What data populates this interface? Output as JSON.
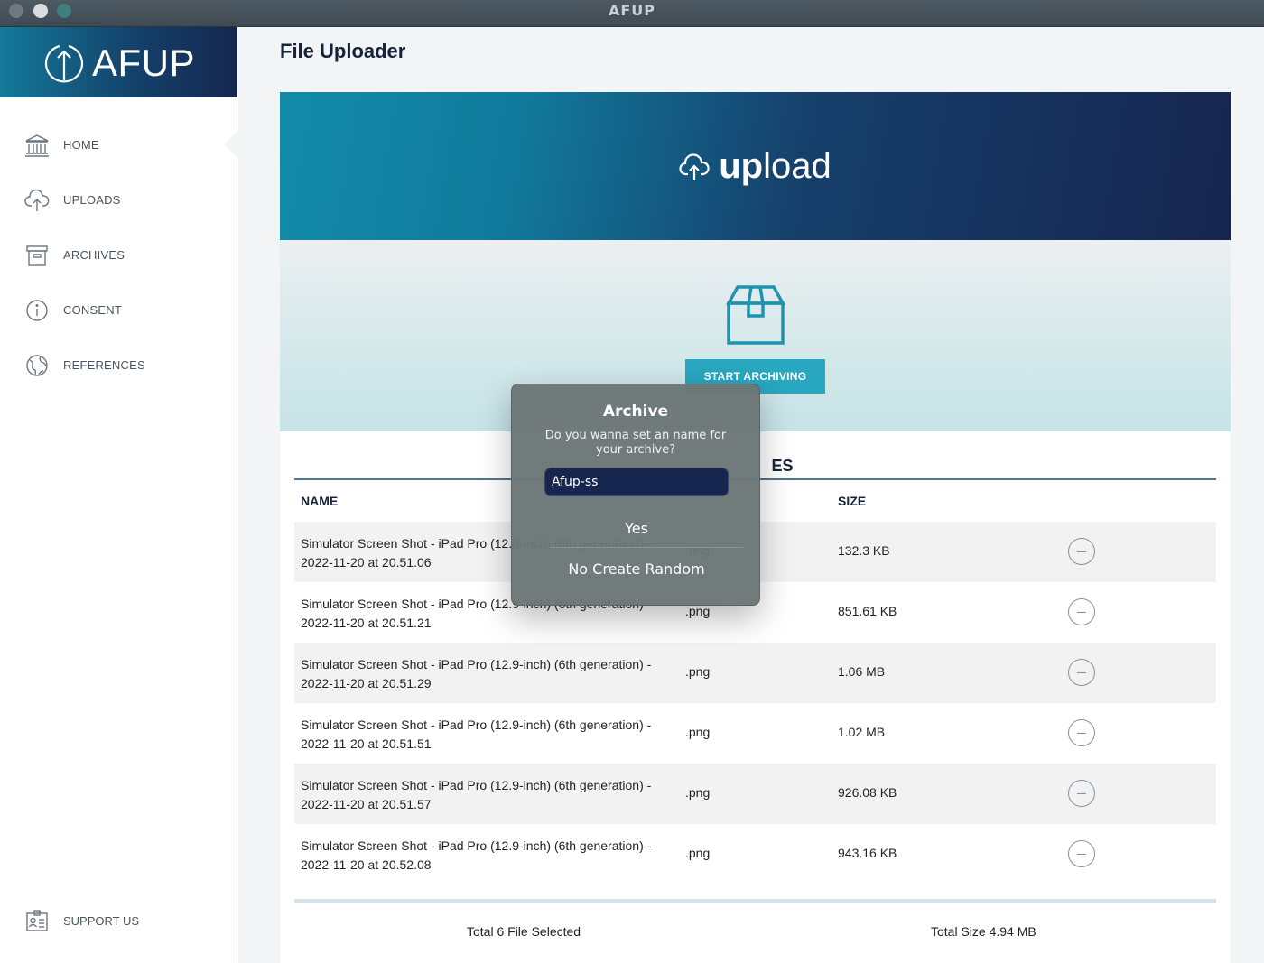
{
  "window": {
    "title": "AFUP"
  },
  "sidebar": {
    "brand": "AFUP",
    "items": [
      {
        "label": "HOME",
        "icon": "bank-icon",
        "active": true
      },
      {
        "label": "UPLOADS",
        "icon": "cloud-upload-icon"
      },
      {
        "label": "ARCHIVES",
        "icon": "archive-box-icon"
      },
      {
        "label": "CONSENT",
        "icon": "info-icon"
      },
      {
        "label": "REFERENCES",
        "icon": "globe-icon"
      }
    ],
    "support": {
      "label": "SUPPORT US",
      "icon": "id-card-icon"
    }
  },
  "main": {
    "title": "File Uploader",
    "hero": {
      "bold": "up",
      "light": "load",
      "icon": "cloud-upload-icon"
    },
    "archive_button": "START ARCHIVING",
    "files_heading_visible": "ES",
    "table": {
      "headers": {
        "name": "NAME",
        "type": "",
        "size": "SIZE"
      },
      "rows": [
        {
          "name": "Simulator Screen Shot - iPad Pro (12.9-inch) (6th generation) - 2022-11-20 at 20.51.06",
          "type": ".png",
          "size": "132.3 KB"
        },
        {
          "name": "Simulator Screen Shot - iPad Pro (12.9-inch) (6th generation) - 2022-11-20 at 20.51.21",
          "type": ".png",
          "size": "851.61 KB"
        },
        {
          "name": "Simulator Screen Shot - iPad Pro (12.9-inch) (6th generation) - 2022-11-20 at 20.51.29",
          "type": ".png",
          "size": "1.06 MB"
        },
        {
          "name": "Simulator Screen Shot - iPad Pro (12.9-inch) (6th generation) - 2022-11-20 at 20.51.51",
          "type": ".png",
          "size": "1.02 MB"
        },
        {
          "name": "Simulator Screen Shot - iPad Pro (12.9-inch) (6th generation) - 2022-11-20 at 20.51.57",
          "type": ".png",
          "size": "926.08 KB"
        },
        {
          "name": "Simulator Screen Shot - iPad Pro (12.9-inch) (6th generation) - 2022-11-20 at 20.52.08",
          "type": ".png",
          "size": "943.16 KB"
        }
      ]
    },
    "totals": {
      "count": "Total 6 File Selected",
      "size": "Total Size 4.94 MB"
    }
  },
  "dialog": {
    "title": "Archive",
    "message": "Do you wanna set an name for your archive?",
    "input_value": "Afup-ss",
    "yes": "Yes",
    "no": "No Create Random"
  },
  "colors": {
    "brand_gradient_start": "#137a9a",
    "brand_gradient_end": "#16264f",
    "accent": "#29a6c0",
    "dialog_bg": "#6c7676",
    "input_bg": "#17264f"
  }
}
